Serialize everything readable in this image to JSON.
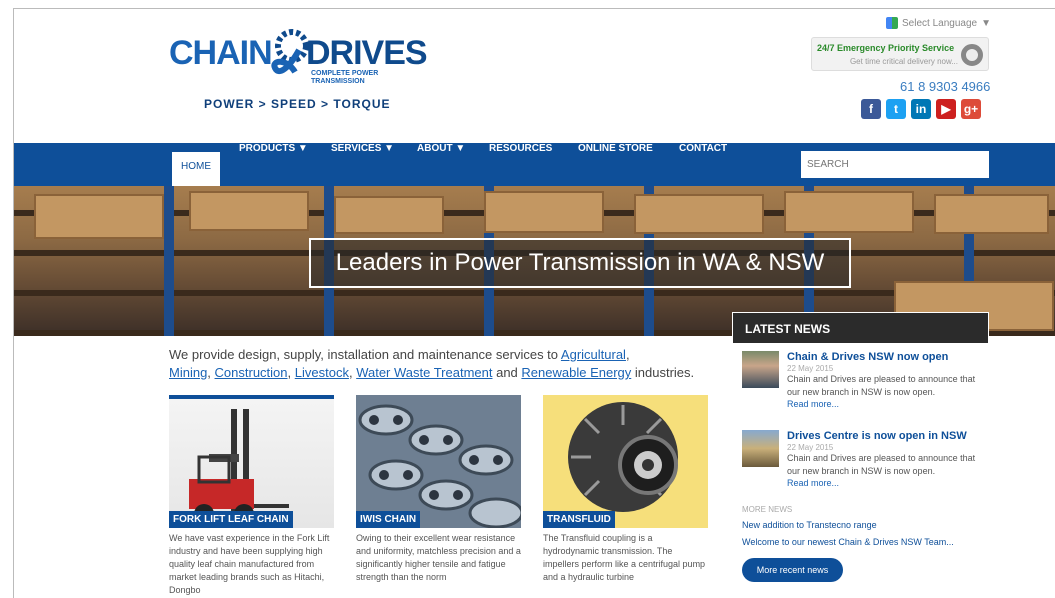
{
  "header": {
    "logo_left": "CHAIN",
    "logo_right": "DRIVES",
    "logo_sub": "COMPLETE POWER TRANSMISSION",
    "tagline": "POWER > SPEED > TORQUE",
    "language_label": "Select Language",
    "emergency_title": "24/7 Emergency Priority Service",
    "emergency_sub": "Get time critical delivery now...",
    "phone": "61 8 9303 4966",
    "social": [
      {
        "name": "facebook-icon",
        "glyph": "f",
        "color": "#3b5998"
      },
      {
        "name": "twitter-icon",
        "glyph": "t",
        "color": "#1da1f2"
      },
      {
        "name": "linkedin-icon",
        "glyph": "in",
        "color": "#0077b5"
      },
      {
        "name": "youtube-icon",
        "glyph": "▶",
        "color": "#cd201f"
      },
      {
        "name": "googleplus-icon",
        "glyph": "g+",
        "color": "#dd4b39"
      }
    ]
  },
  "nav": {
    "items": [
      {
        "label": "HOME"
      },
      {
        "label": "PRODUCTS ▼"
      },
      {
        "label": "SERVICES ▼"
      },
      {
        "label": "ABOUT ▼"
      },
      {
        "label": "RESOURCES"
      },
      {
        "label": "ONLINE STORE"
      },
      {
        "label": "CONTACT"
      }
    ],
    "search_placeholder": "SEARCH"
  },
  "hero": {
    "title_prefix": "Leaders in ",
    "title_bold": "Power Transmission",
    "title_suffix": " in WA & NSW"
  },
  "intro": {
    "lead": "We provide design, supply, installation and maintenance services to ",
    "links": [
      "Agricultural",
      "Mining",
      "Construction",
      "Livestock",
      "Water Waste Treatment",
      "Renewable Energy"
    ],
    "sep1": ", ",
    "and": " and ",
    "tail": " industries."
  },
  "cards": [
    {
      "badge": "FORK LIFT LEAF CHAIN",
      "desc": "We have vast experience in the Fork Lift industry and have been supplying high quality leaf chain manufactured from market leading brands such as Hitachi, Dongbo"
    },
    {
      "badge": "IWIS CHAIN",
      "desc": "Owing to their excellent wear resistance and uniformity, matchless precision and a significantly higher tensile and fatigue strength than the norm"
    },
    {
      "badge": "TRANSFLUID",
      "desc": "The Transfluid coupling is a hydrodynamic transmission. The impellers perform like a centrifugal pump and a hydraulic turbine"
    }
  ],
  "news": {
    "heading": "LATEST NEWS",
    "items": [
      {
        "title": "Chain & Drives NSW now open",
        "date": "22 May 2015",
        "text": "Chain and Drives are pleased to announce that our new branch in NSW is now open.",
        "more": "Read more..."
      },
      {
        "title": "Drives Centre is now open in NSW",
        "date": "22 May 2015",
        "text": "Chain and Drives are pleased to announce that our new branch in NSW is now open.",
        "more": "Read more..."
      }
    ],
    "more_news_label": "MORE NEWS",
    "more_links": [
      "New addition to Transtecno range",
      "Welcome to our newest Chain & Drives NSW Team..."
    ],
    "more_button": "More recent news"
  }
}
